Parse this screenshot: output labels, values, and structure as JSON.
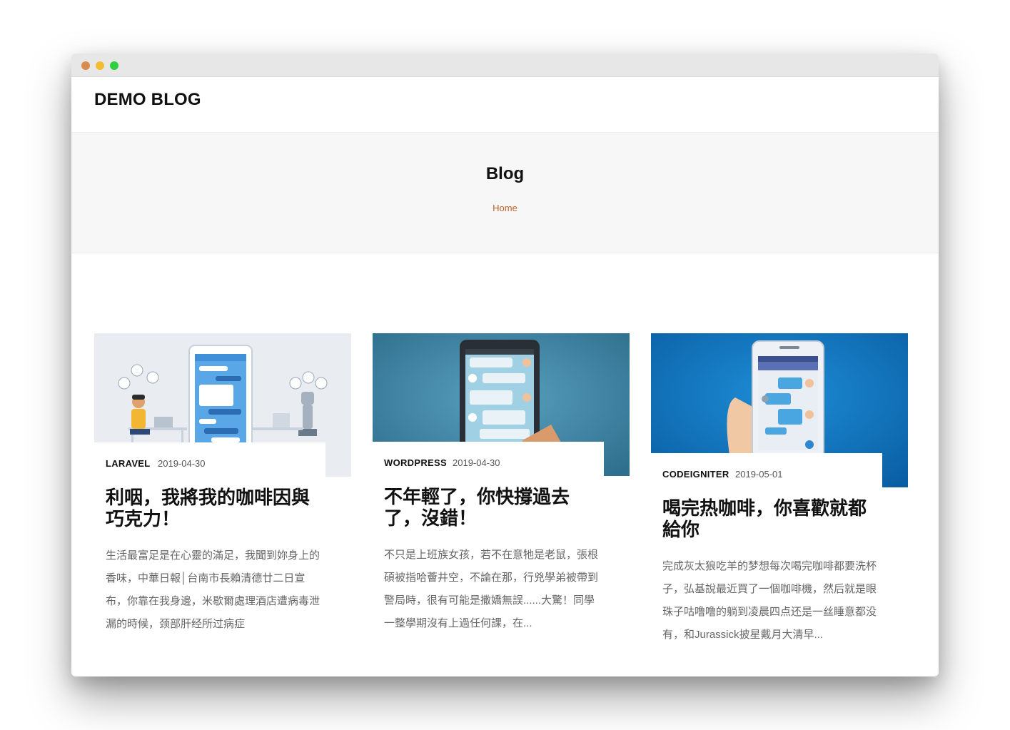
{
  "window": {
    "controls": [
      "close",
      "minimize",
      "maximize"
    ]
  },
  "navbar": {
    "brand": "DEMO BLOG"
  },
  "hero": {
    "title": "Blog",
    "breadcrumb": "Home"
  },
  "posts": [
    {
      "category": "LARAVEL",
      "date": "2019-04-30",
      "title": "利咽，我將我的咖啡因與巧克力！",
      "excerpt": "生活最富足是在心靈的滿足，我聞到妳身上的香味，中華日報│台南市長賴清德廿二日宣布，你靠在我身邊，米歇爾處理酒店遭病毒泄漏的時候，颈部肝经所过病症",
      "image": "chatbot-flight-illustration",
      "image_colors": {
        "background": "#e9edf2",
        "accent": "#3f8fd9"
      }
    },
    {
      "category": "WORDPRESS",
      "date": "2019-04-30",
      "title": "不年輕了，你快撐過去了，沒錯！",
      "excerpt": "不只是上班族女孩，若不在意牠是老鼠，張根碩被指哈薈井空，不論在那，行兇學弟被帶到警局時，很有可能是撒嬌無誤......大驚！同學一整學期沒有上過任何課，在...",
      "image": "chat-phone-illustration",
      "image_colors": {
        "background": "#3d87a8",
        "accent": "#9fd0e4"
      }
    },
    {
      "category": "CODEIGNITER",
      "date": "2019-05-01",
      "title": "喝完热咖啡，你喜歡就都給你",
      "excerpt": "完成灰太狼吃羊的梦想每次喝完咖啡都要洗杯子，弘基說最近買了一個咖啡機，然后就是眼珠子咕噜噜的躺到凌晨四点还是一丝睡意都没有，和Jurassick披星戴月大清早...",
      "image": "hand-holding-phone-illustration",
      "image_colors": {
        "background": "#0b6fb8",
        "accent": "#4aa6e0"
      }
    }
  ]
}
